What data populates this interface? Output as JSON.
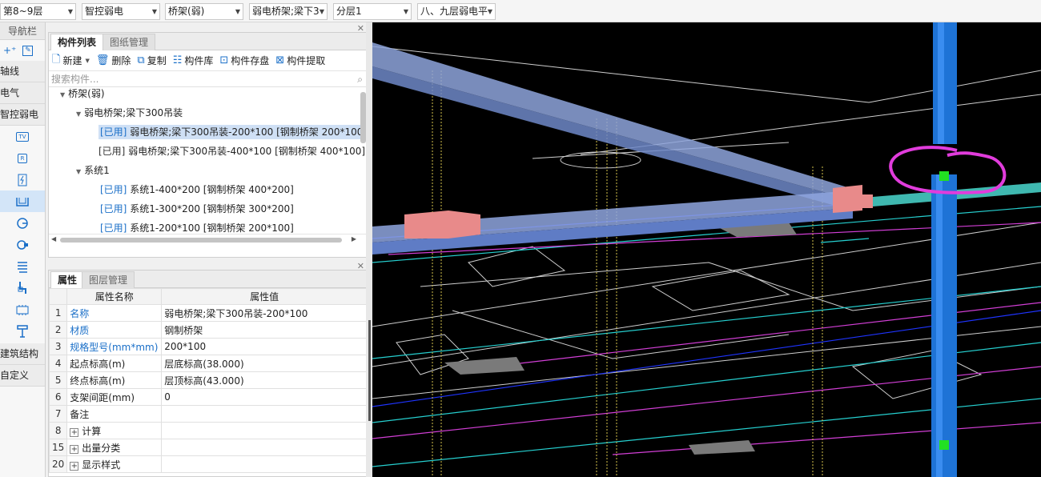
{
  "topbar": {
    "floor": "第8~9层",
    "discipline": "智控弱电",
    "component_type": "桥架(弱)",
    "component": "弱电桥架;梁下3",
    "sublayer": "分层1",
    "drawing": "八、九层弱电平"
  },
  "nav": {
    "title": "导航栏",
    "categories": [
      "轴线",
      "电气",
      "智控弱电",
      "建筑结构",
      "自定义"
    ],
    "icons": [
      "tv-outlet-icon",
      "router-icon",
      "panel-icon",
      "cable-tray-icon",
      "camera-icon",
      "speaker-icon",
      "ladder-icon",
      "pipe-icon",
      "rack-icon",
      "terminal-icon"
    ],
    "icon_labels": {
      "tv": "TV",
      "r": "R"
    }
  },
  "component_panel": {
    "tabs": [
      "构件列表",
      "图纸管理"
    ],
    "toolbar": [
      "新建",
      "删除",
      "复制",
      "构件库",
      "构件存盘",
      "构件提取"
    ],
    "search_placeholder": "搜索构件...",
    "tree": [
      {
        "text": "桥架(弱)",
        "level": 0,
        "tag": ""
      },
      {
        "text": "弱电桥架;梁下300吊装",
        "level": 1,
        "tag": ""
      },
      {
        "text": "弱电桥架;梁下300吊装-200*100 [钢制桥架 200*100]",
        "level": 2,
        "tag": "[已用]",
        "selected": true
      },
      {
        "text": "弱电桥架;梁下300吊装-400*100 [钢制桥架 400*100]",
        "level": 2,
        "tag": "[已用]"
      },
      {
        "text": "系统1",
        "level": 1,
        "tag": ""
      },
      {
        "text": "系统1-400*200 [钢制桥架 400*200]",
        "level": 2,
        "tag": "[已用]"
      },
      {
        "text": "系统1-300*200 [钢制桥架 300*200]",
        "level": 2,
        "tag": "[已用]"
      },
      {
        "text": "系统1-200*100 [钢制桥架 200*100]",
        "level": 2,
        "tag": "[已用]"
      }
    ]
  },
  "property_panel": {
    "tabs": [
      "属性",
      "图层管理"
    ],
    "headers": [
      "属性名称",
      "属性值"
    ],
    "rows": [
      {
        "n": "1",
        "name": "名称",
        "value": "弱电桥架;梁下300吊装-200*100",
        "blue": true
      },
      {
        "n": "2",
        "name": "材质",
        "value": "钢制桥架",
        "blue": true
      },
      {
        "n": "3",
        "name": "规格型号(mm*mm)",
        "value": "200*100",
        "blue": true
      },
      {
        "n": "4",
        "name": "起点标高(m)",
        "value": "层底标高(38.000)",
        "blue": false
      },
      {
        "n": "5",
        "name": "终点标高(m)",
        "value": "层顶标高(43.000)",
        "blue": false
      },
      {
        "n": "6",
        "name": "支架间距(mm)",
        "value": "0",
        "blue": false
      },
      {
        "n": "7",
        "name": "备注",
        "value": "",
        "blue": false
      },
      {
        "n": "8",
        "name": "计算",
        "value": "",
        "group": true
      },
      {
        "n": "15",
        "name": "出量分类",
        "value": "",
        "group": true
      },
      {
        "n": "20",
        "name": "显示样式",
        "value": "",
        "group": true
      }
    ]
  },
  "colors": {
    "accent": "#1a6fc8",
    "tray": "#7f9fe0",
    "riser": "#1e73d6",
    "annotation": "#e13cdc",
    "cyan_tray": "#3fb8b0"
  }
}
